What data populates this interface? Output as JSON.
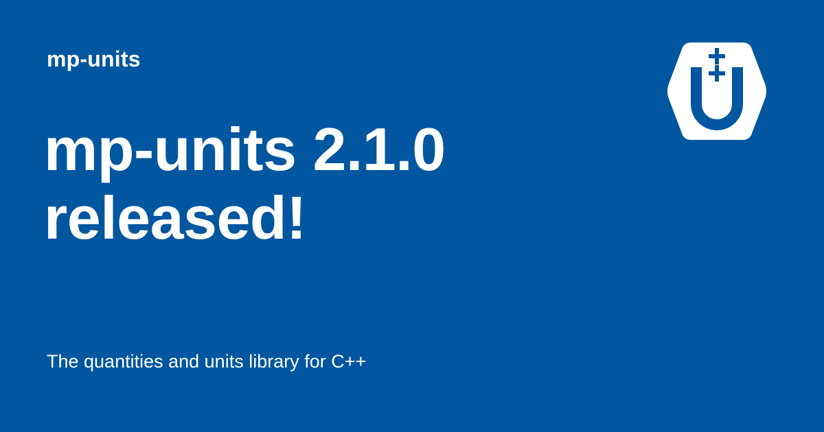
{
  "site": {
    "name": "mp-units"
  },
  "post": {
    "title": "mp-units 2.1.0 released!",
    "description": "The quantities and units library for C++"
  },
  "logo": {
    "icon": "mp-units-logo-icon"
  },
  "colors": {
    "background": "#00569f",
    "text": "#ffffff"
  }
}
